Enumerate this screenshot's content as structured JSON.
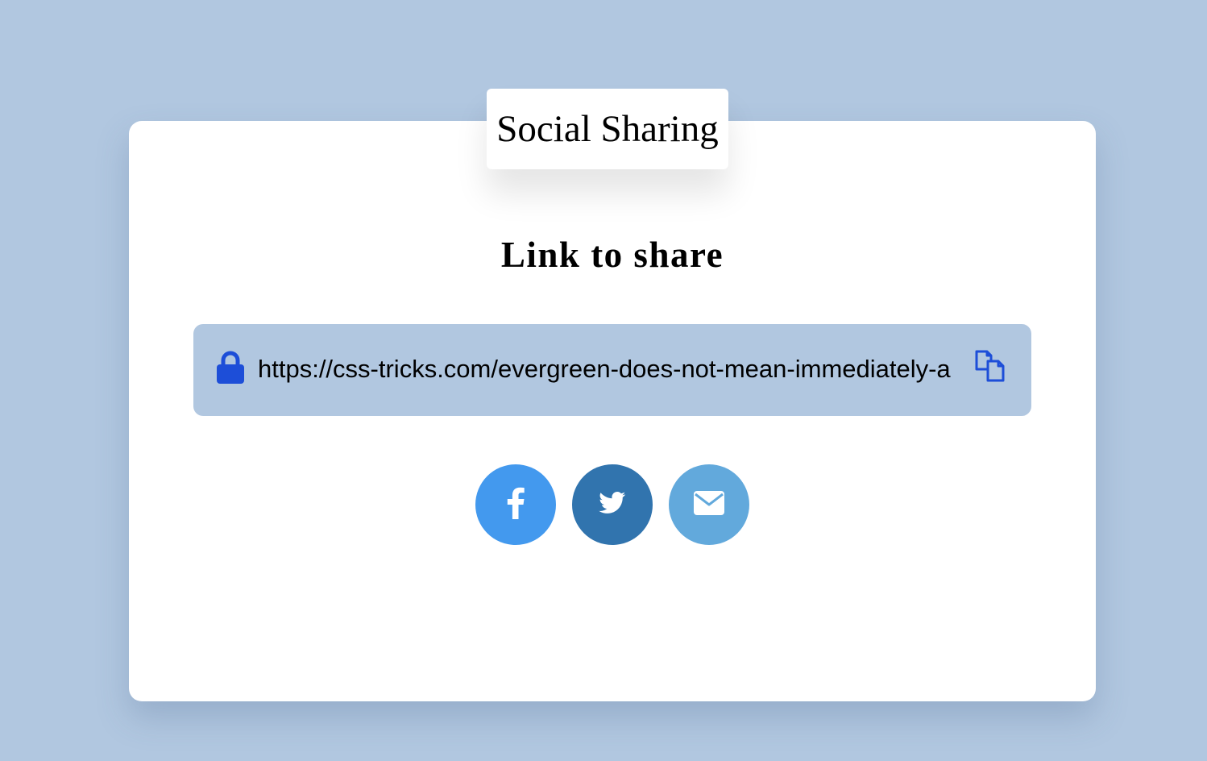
{
  "title_tab": {
    "label": "Social Sharing"
  },
  "heading": "Link to share",
  "link_field": {
    "value": "https://css-tricks.com/evergreen-does-not-mean-immediately-a",
    "lock_icon": "lock-icon",
    "copy_icon": "copy-icon"
  },
  "share_buttons": [
    {
      "name": "facebook",
      "icon": "facebook-icon",
      "color": "#4399ee"
    },
    {
      "name": "twitter",
      "icon": "twitter-icon",
      "color": "#3174ae"
    },
    {
      "name": "email",
      "icon": "envelope-icon",
      "color": "#62a9dc"
    }
  ],
  "colors": {
    "background": "#b1c7e0",
    "card": "#ffffff",
    "accent_icon": "#1d4ed8"
  }
}
